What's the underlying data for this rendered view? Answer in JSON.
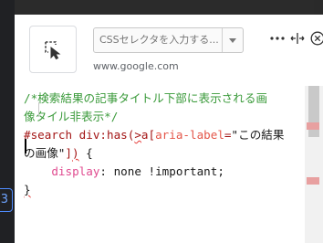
{
  "selector_input": {
    "placeholder": "CSSセレクタを入力する..."
  },
  "domain": "www.google.com",
  "code_lines": [
    {
      "parts": [
        {
          "t": "/*検索結果の記事タイトル下部に表示される画",
          "c": "c-comment"
        }
      ]
    },
    {
      "parts": [
        {
          "t": "像タイル非表示*/",
          "c": "c-comment"
        }
      ]
    },
    {
      "parts": [
        {
          "t": "#search div:has(",
          "c": "c-sel"
        },
        {
          "t": ">",
          "c": "c-sel wavy"
        },
        {
          "t": "a[",
          "c": "c-sel"
        },
        {
          "t": "aria-label",
          "c": "c-attr"
        },
        {
          "t": "=",
          "c": "c-sel"
        },
        {
          "t": "\"この結果",
          "c": "c-str"
        }
      ]
    },
    {
      "parts": [
        {
          "t": "の画像\"",
          "c": "c-str"
        },
        {
          "t": "]",
          "c": "c-sel"
        },
        {
          "t": ")",
          "c": "c-sel wavy"
        },
        {
          "t": " {",
          "c": "c-val"
        }
      ]
    },
    {
      "parts": [
        {
          "t": "    display",
          "c": "c-prop"
        },
        {
          "t": ": ",
          "c": "c-val"
        },
        {
          "t": "none !important",
          "c": "c-val"
        },
        {
          "t": ";",
          "c": "c-val"
        }
      ]
    },
    {
      "parts": [
        {
          "t": "}",
          "c": "c-val wavy"
        }
      ]
    },
    {
      "parts": [
        {
          "t": "",
          "c": "c-val"
        }
      ]
    }
  ],
  "background_badge": "3"
}
